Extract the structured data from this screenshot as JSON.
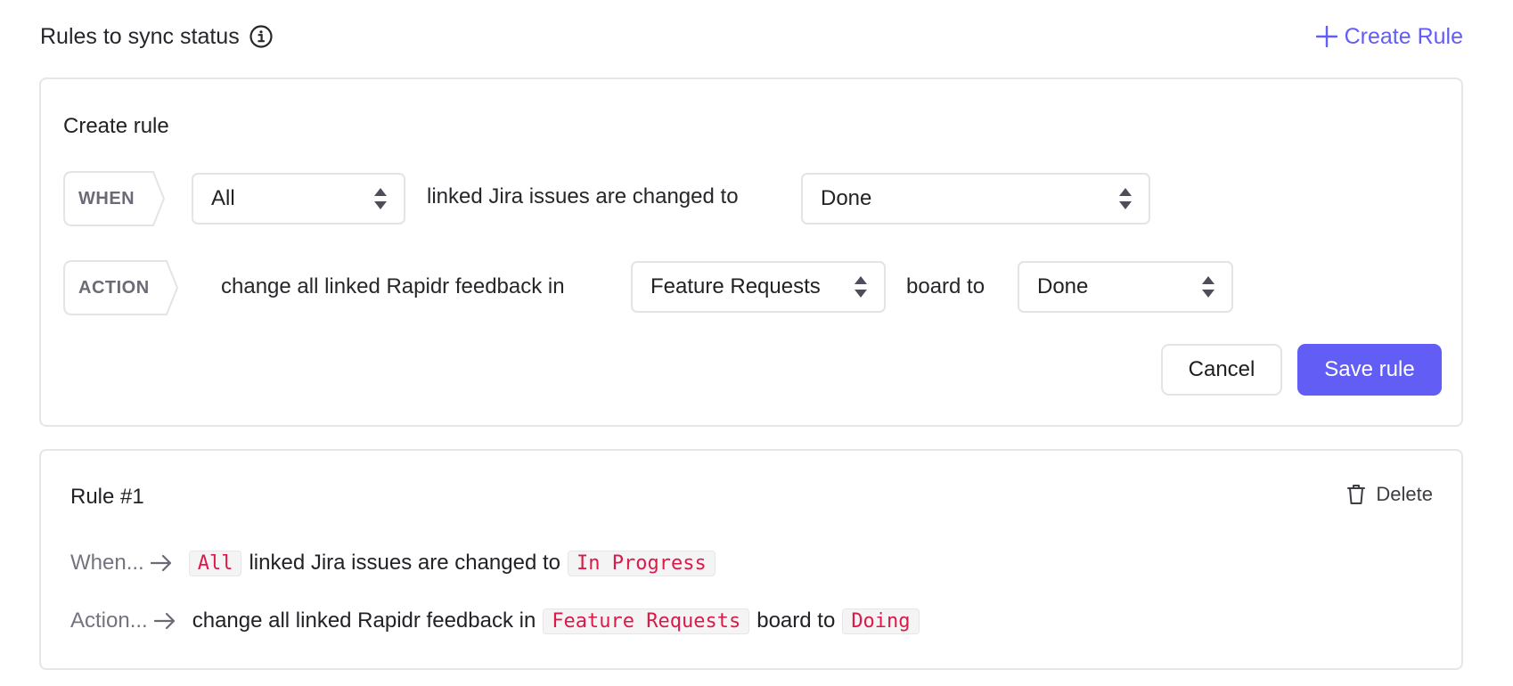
{
  "header": {
    "title": "Rules to sync status",
    "info_icon": "info-circle-icon",
    "create_rule_label": "Create Rule",
    "create_rule_icon": "plus-icon"
  },
  "create_rule_form": {
    "heading": "Create rule",
    "when": {
      "tag": "WHEN",
      "scope_select": {
        "value": "All",
        "icon": "select-updown-icon"
      },
      "text": "linked Jira issues are changed to",
      "status_select": {
        "value": "Done",
        "icon": "select-updown-icon"
      }
    },
    "action": {
      "tag": "ACTION",
      "text": "change all linked Rapidr feedback in",
      "board_select": {
        "value": "Feature Requests",
        "icon": "select-updown-icon"
      },
      "text2": "board to",
      "status_select": {
        "value": "Done",
        "icon": "select-updown-icon"
      }
    },
    "cancel_label": "Cancel",
    "save_label": "Save rule"
  },
  "rules": [
    {
      "title": "Rule #1",
      "delete_label": "Delete",
      "delete_icon": "trash-icon",
      "when_label": "When...",
      "when_scope": "All",
      "when_text": "linked Jira issues are changed to",
      "when_status": "In Progress",
      "action_label": "Action...",
      "action_text": "change all linked Rapidr feedback in",
      "action_board": "Feature Requests",
      "action_text2": "board to",
      "action_status": "Doing"
    }
  ],
  "colors": {
    "accent": "#625df5",
    "code_text": "#dc1a4a",
    "border": "#e6e6e8",
    "muted_text": "#74747e"
  }
}
